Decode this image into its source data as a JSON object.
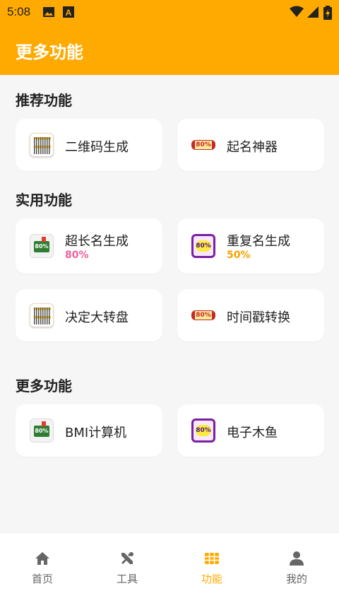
{
  "status_bar": {
    "time": "5:08",
    "icons": [
      "image-icon",
      "font-app-icon",
      "wifi-icon",
      "signal-icon",
      "battery-charging-icon"
    ]
  },
  "app_bar": {
    "title": "更多功能"
  },
  "sections": {
    "recommended": {
      "title": "推荐功能",
      "items": [
        {
          "label": "二维码生成",
          "icon": "qr-code-icon"
        },
        {
          "label": "起名神器",
          "icon": "ticket-icon"
        }
      ]
    },
    "practical": {
      "title": "实用功能",
      "items": [
        {
          "label": "超长名生成",
          "progress": "80%",
          "icon": "green-card-icon"
        },
        {
          "label": "重复名生成",
          "progress": "50%",
          "icon": "purple-badge-icon"
        },
        {
          "label": "决定大转盘",
          "icon": "qr-code-icon"
        },
        {
          "label": "时间戳转换",
          "icon": "ticket-icon"
        }
      ]
    },
    "more": {
      "title": "更多功能",
      "items": [
        {
          "label": "BMI计算机",
          "icon": "green-card-icon"
        },
        {
          "label": "电子木鱼",
          "icon": "purple-badge-icon"
        }
      ]
    }
  },
  "colors": {
    "accent": "#ffaa00",
    "progress_pink": "#f0609e",
    "progress_orange": "#f5a300",
    "nav_inactive": "#666666"
  },
  "bottom_nav": [
    {
      "label": "首页",
      "icon": "home-icon",
      "active": false
    },
    {
      "label": "工具",
      "icon": "tools-icon",
      "active": false
    },
    {
      "label": "功能",
      "icon": "grid-icon",
      "active": true
    },
    {
      "label": "我的",
      "icon": "person-icon",
      "active": false
    }
  ]
}
